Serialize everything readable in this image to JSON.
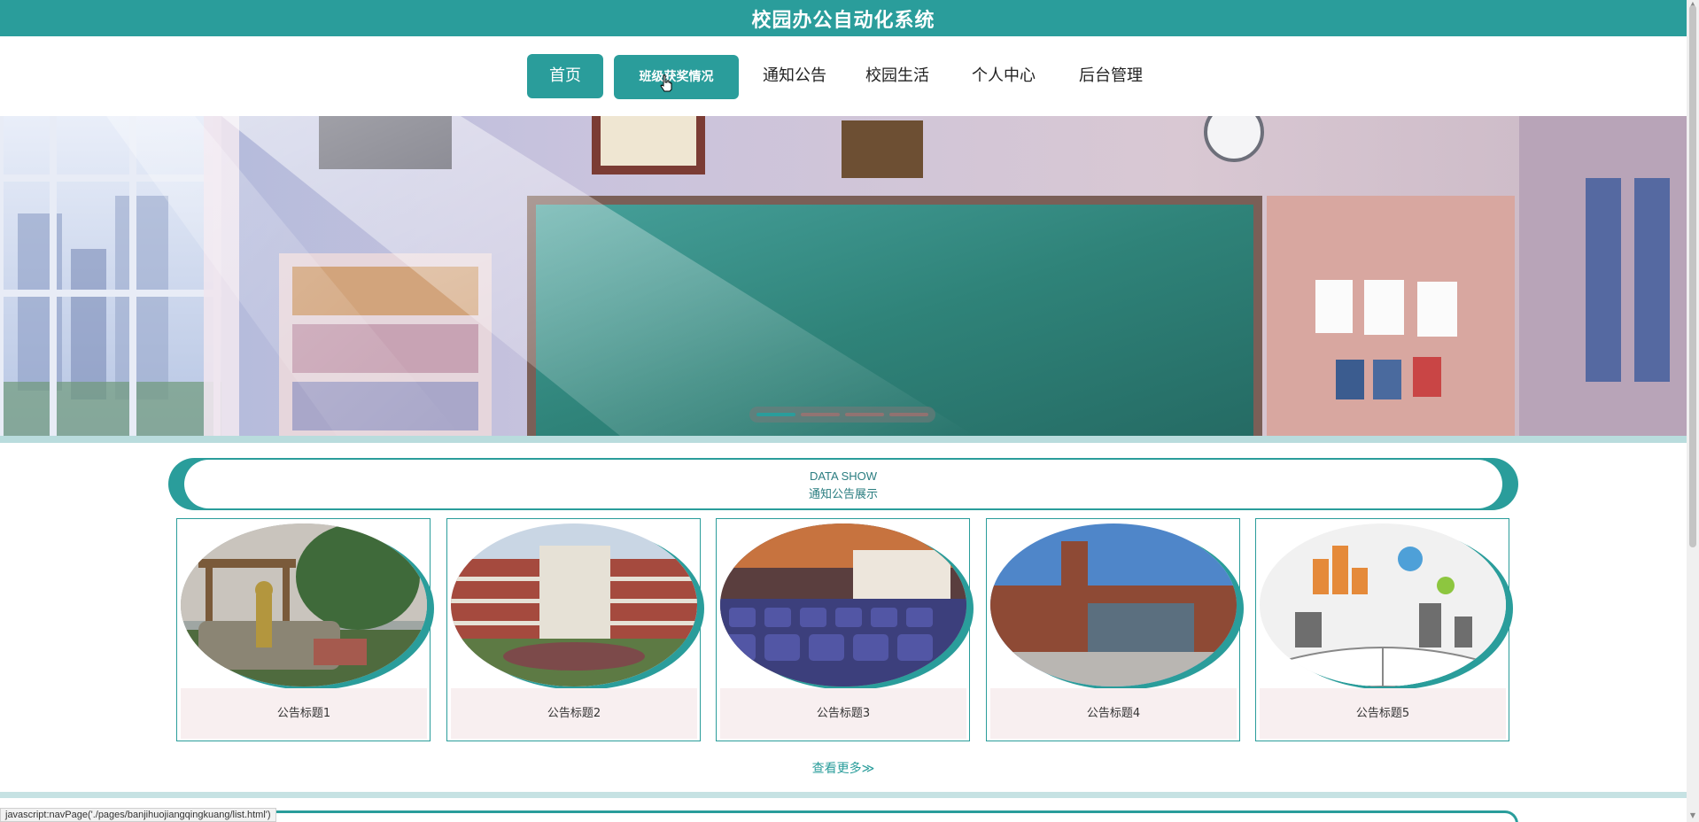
{
  "header": {
    "title": "校园办公自动化系统"
  },
  "nav": {
    "items": [
      {
        "label": "首页"
      },
      {
        "label": "班级获奖情况"
      },
      {
        "label": "通知公告"
      },
      {
        "label": "校园生活"
      },
      {
        "label": "个人中心"
      },
      {
        "label": "后台管理"
      }
    ]
  },
  "banner": {
    "slides": 4,
    "active_slide": 1
  },
  "section": {
    "en_title": "DATA SHOW",
    "cn_title": "通知公告展示"
  },
  "cards": [
    {
      "title": "公告标题1"
    },
    {
      "title": "公告标题2"
    },
    {
      "title": "公告标题3"
    },
    {
      "title": "公告标题4"
    },
    {
      "title": "公告标题5"
    }
  ],
  "more": {
    "label": "查看更多≫"
  },
  "status": {
    "url": "javascript:navPage('./pages/banjihuojiangqingkuang/list.html')"
  },
  "colors": {
    "accent": "#2a9d9b",
    "caption_bg": "#f8eff0"
  }
}
